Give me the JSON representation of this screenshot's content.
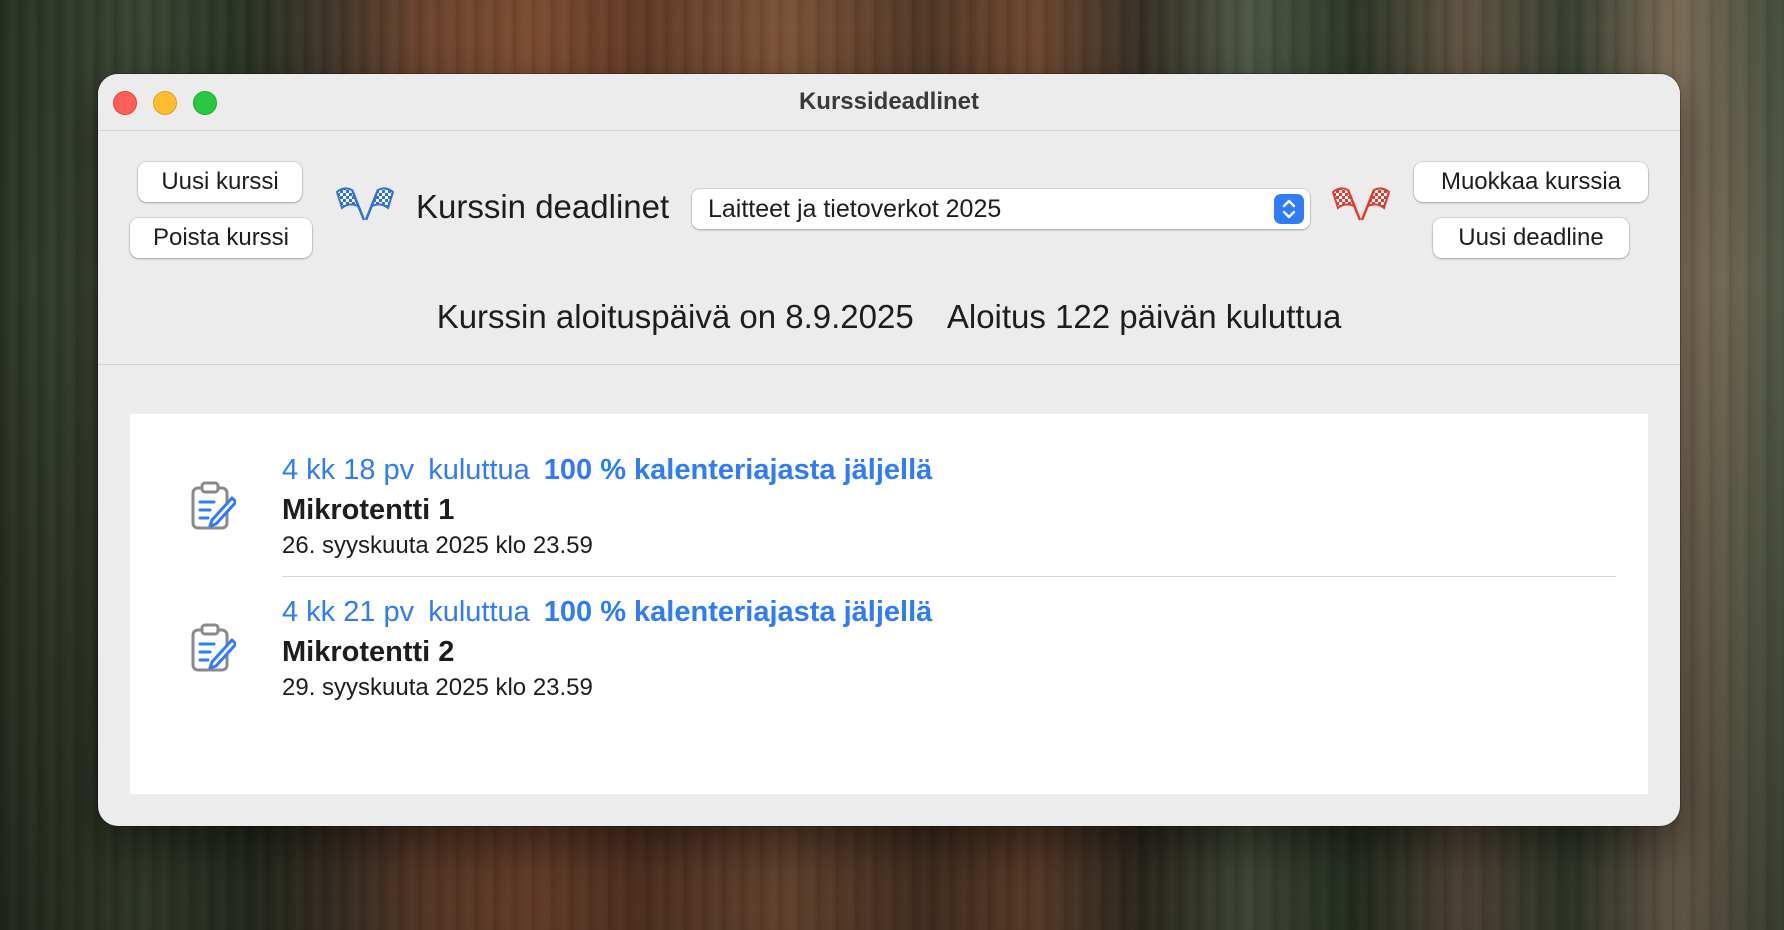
{
  "window": {
    "title": "Kurssideadlinet"
  },
  "toolbar": {
    "new_course": "Uusi kurssi",
    "delete_course": "Poista kurssi",
    "heading": "Kurssin deadlinet",
    "course_select_value": "Laitteet ja tietoverkot 2025",
    "edit_course": "Muokkaa kurssia",
    "new_deadline": "Uusi deadline"
  },
  "info": {
    "start_date_text": "Kurssin aloituspäivä on 8.9.2025",
    "countdown_text": "Aloitus 122 päivän kuluttua"
  },
  "deadlines": [
    {
      "time_left": "4 kk 18 pv",
      "time_left_suffix": "kuluttua",
      "percent_left": "100 % kalenteriajasta jäljellä",
      "name": "Mikrotentti 1",
      "due": "26. syyskuuta 2025 klo 23.59"
    },
    {
      "time_left": "4 kk 21 pv",
      "time_left_suffix": "kuluttua",
      "percent_left": "100 % kalenteriajasta jäljellä",
      "name": "Mikrotentti 2",
      "due": "29. syyskuuta 2025 klo 23.59"
    }
  ],
  "colors": {
    "accent": "#2f7cf6",
    "flag_blue": "#2f6fe0",
    "flag_red": "#e23b2e",
    "window_bg": "#ececec",
    "list_bg": "#ffffff"
  },
  "icons": {
    "flag_left": "checkered-flags-icon-blue",
    "flag_right": "checkered-flags-icon-red",
    "row_icon": "clipboard-edit-icon"
  }
}
